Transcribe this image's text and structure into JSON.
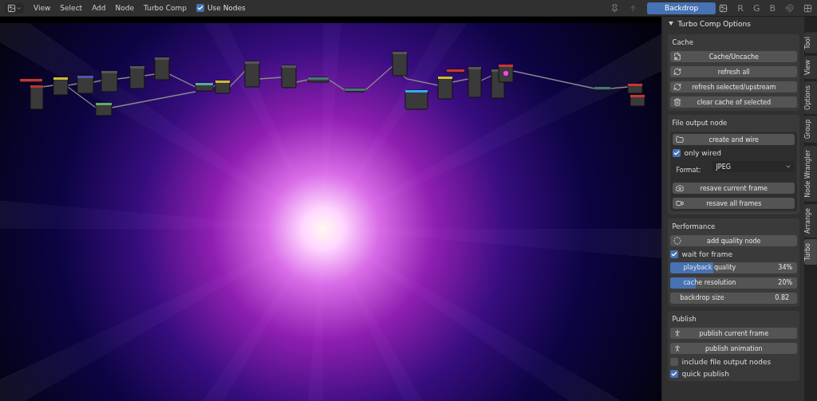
{
  "header": {
    "menus": [
      "View",
      "Select",
      "Add",
      "Node",
      "Turbo Comp"
    ],
    "use_nodes": {
      "label": "Use Nodes",
      "checked": true
    },
    "backdrop": {
      "label": "Backdrop",
      "selected": true
    },
    "channels": [
      "R",
      "G",
      "B"
    ]
  },
  "panel": {
    "title": "Turbo Comp Options",
    "expanded": true,
    "sections": [
      {
        "title": "Cache",
        "items": [
          {
            "kind": "button",
            "label": "Cache/Uncache"
          },
          {
            "kind": "button",
            "label": "refresh all"
          },
          {
            "kind": "button",
            "label": "refresh selected/upstream"
          },
          {
            "kind": "button",
            "label": "clear cache of selected"
          }
        ]
      },
      {
        "title": "File output node",
        "items": [
          {
            "kind": "button",
            "label": "create and wire"
          },
          {
            "kind": "checkbox",
            "label": "only wired",
            "checked": true
          },
          {
            "kind": "select",
            "label": "Format:",
            "value": "JPEG"
          },
          {
            "kind": "button",
            "label": "resave current frame"
          },
          {
            "kind": "button",
            "label": "resave all frames"
          }
        ]
      },
      {
        "title": "Performance",
        "items": [
          {
            "kind": "button",
            "label": "add quality node"
          },
          {
            "kind": "checkbox",
            "label": "wait for frame",
            "checked": true
          },
          {
            "kind": "slider",
            "label": "playback quality",
            "value": "34%",
            "level": 0.34
          },
          {
            "kind": "slider",
            "label": "cache resolution",
            "value": "20%",
            "level": 0.2
          },
          {
            "kind": "number",
            "label": "backdrop size",
            "value": "0.82"
          }
        ]
      },
      {
        "title": "Publish",
        "items": [
          {
            "kind": "button",
            "label": "publish current frame"
          },
          {
            "kind": "button",
            "label": "publish animation"
          },
          {
            "kind": "checkbox",
            "label": "include file output nodes",
            "checked": false
          },
          {
            "kind": "checkbox",
            "label": "quick publish",
            "checked": true
          }
        ]
      }
    ]
  },
  "tabs": [
    {
      "label": "Tool",
      "selected": false
    },
    {
      "label": "View",
      "selected": false
    },
    {
      "label": "Options",
      "selected": false
    },
    {
      "label": "Group",
      "selected": false
    },
    {
      "label": "Node Wrangler",
      "selected": false
    },
    {
      "label": "Arrange",
      "selected": false
    },
    {
      "label": "Turbo",
      "selected": true
    }
  ]
}
